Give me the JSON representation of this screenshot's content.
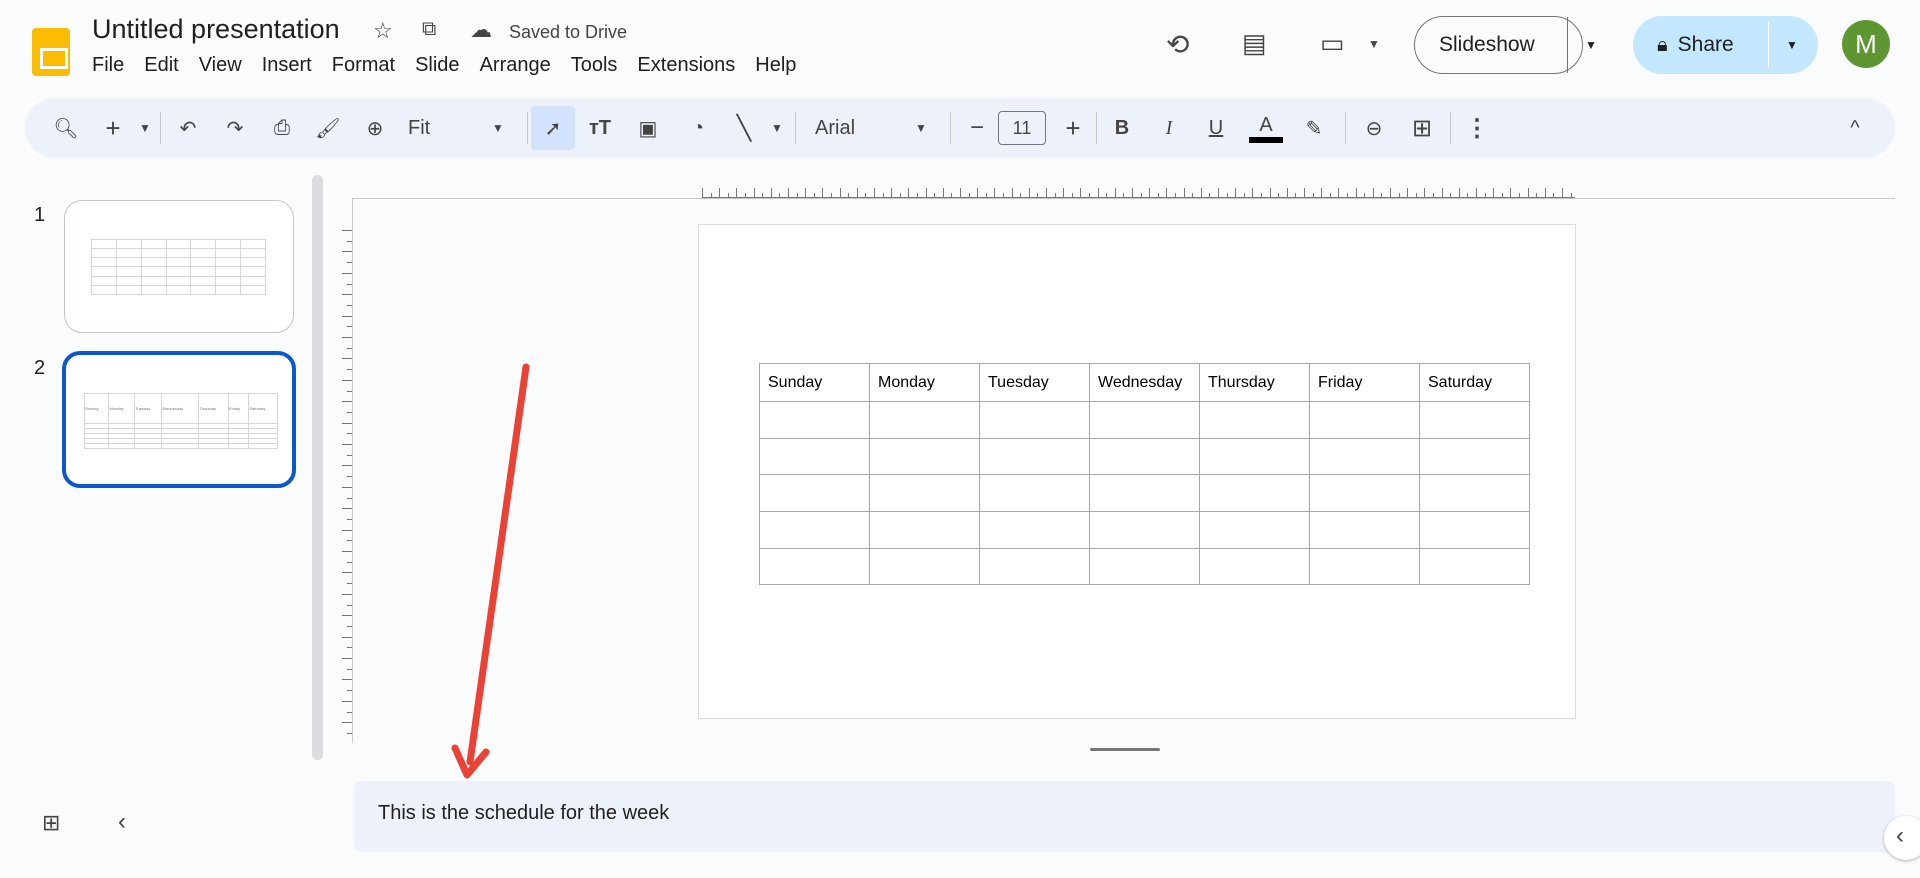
{
  "doc": {
    "title": "Untitled presentation",
    "save_status": "Saved to Drive"
  },
  "menu": [
    "File",
    "Edit",
    "View",
    "Insert",
    "Format",
    "Slide",
    "Arrange",
    "Tools",
    "Extensions",
    "Help"
  ],
  "toolbar": {
    "zoom": "Fit",
    "font": "Arial",
    "font_size": "11",
    "text_color": "#000000"
  },
  "header": {
    "slideshow": "Slideshow",
    "share": "Share",
    "avatar": "M",
    "avatar_color": "#5e9632"
  },
  "slides": [
    {
      "number": "1"
    },
    {
      "number": "2"
    }
  ],
  "table": {
    "headers": [
      "Sunday",
      "Monday",
      "Tuesday",
      "Wednesday",
      "Thursday",
      "Friday",
      "Saturday"
    ],
    "empty_rows": 5
  },
  "notes": "This is the schedule for the week",
  "accent": "#0b57d0",
  "annotation_color": "#ea4335"
}
